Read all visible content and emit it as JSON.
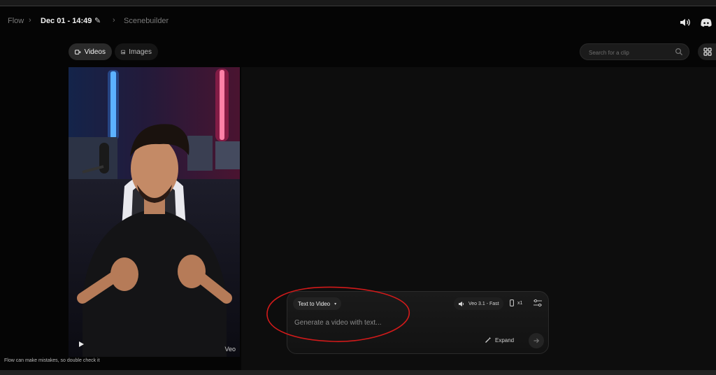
{
  "header": {
    "breadcrumb": [
      {
        "label": "Flow"
      },
      {
        "label": "Dec 01 - 14:49"
      },
      {
        "label": "Scenebuilder"
      }
    ],
    "icons": {
      "edit": "pencil-icon",
      "sound": "speaker-icon",
      "discord": "discord-icon"
    }
  },
  "toolbar": {
    "tabs": [
      {
        "label": "Videos",
        "icon": "video-icon",
        "active": true
      },
      {
        "label": "Images",
        "icon": "image-icon",
        "active": false
      }
    ],
    "search_placeholder": "Search for a clip",
    "view_toggle_icon": "grid-icon"
  },
  "clip": {
    "badge": "Veo",
    "play_icon": "play-icon"
  },
  "composer": {
    "mode": "Text to Video",
    "model": "Veo 3.1 - Fast",
    "count": "x1",
    "prompt_placeholder": "Generate a video with text...",
    "expand_label": "Expand",
    "send_icon": "arrow-right-icon",
    "settings_icon": "sliders-icon"
  },
  "footer": {
    "disclaimer": "Flow can make mistakes, so double check it"
  },
  "colors": {
    "background": "#050505",
    "panel": "#0d0d0d",
    "annotation": "#d11a1a"
  }
}
